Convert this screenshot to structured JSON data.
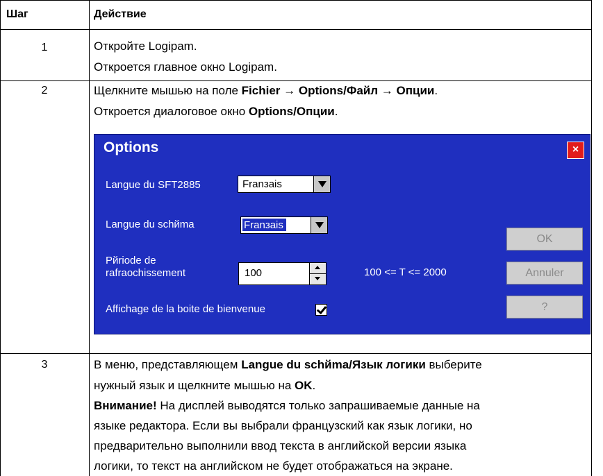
{
  "table": {
    "header": {
      "step": "Шаг",
      "action": "Действие"
    },
    "rows": [
      {
        "step": "1",
        "lines": [
          "Откройте Logipam.",
          "Откроется главное окно Logipam."
        ]
      },
      {
        "step": "2",
        "line1": {
          "a": "Щелкните мышью на поле ",
          "b1": "Fichier",
          "arrow1": " → ",
          "b2": "Options",
          "sep": "/",
          "b3": "Файл",
          "arrow2": " → ",
          "b4": "Опции",
          "end": "."
        },
        "line2": {
          "a": "Откроется диалоговое окно ",
          "b1": "Options",
          "sep": "/",
          "b2": "Опции",
          "end": "."
        }
      },
      {
        "step": "3",
        "line1": {
          "a": "В меню, представляющем ",
          "b1": "Langue du schйma",
          "sep": "/",
          "b2": "Язык логики",
          "c": " выберите"
        },
        "line2": {
          "a": "нужный язык и щелкните мышью на ",
          "b": "OK",
          "end": "."
        },
        "line3": {
          "b": "Внимание!",
          "a": " На дисплей выводятся только запрашиваемые данные на"
        },
        "line4": "языке редактора. Если вы выбрали французский как язык логики, но",
        "line5": "предварительно выполнили ввод текста в английской версии языка",
        "line6": "логики, то текст на английском не будет отображаться на экране."
      }
    ]
  },
  "dialog": {
    "title": "Options",
    "close_label": "×",
    "lang_sft_label": "Langue du SFT2885",
    "lang_sft_value": "Franзais",
    "lang_schema_label": "Langue du schйma",
    "lang_schema_value": "Franзais",
    "period_label_1": "Pйriode de",
    "period_label_2": "rafraоchissement",
    "period_value": "100",
    "period_range": "100 <= T <= 2000",
    "welcome_label": "Affichage de la boite de bienvenue",
    "welcome_checked": true,
    "ok_label": "OK",
    "cancel_label": "Annuler",
    "help_label": "?",
    "colors": {
      "background": "#1f2fbf",
      "close": "#e11b1b"
    }
  }
}
